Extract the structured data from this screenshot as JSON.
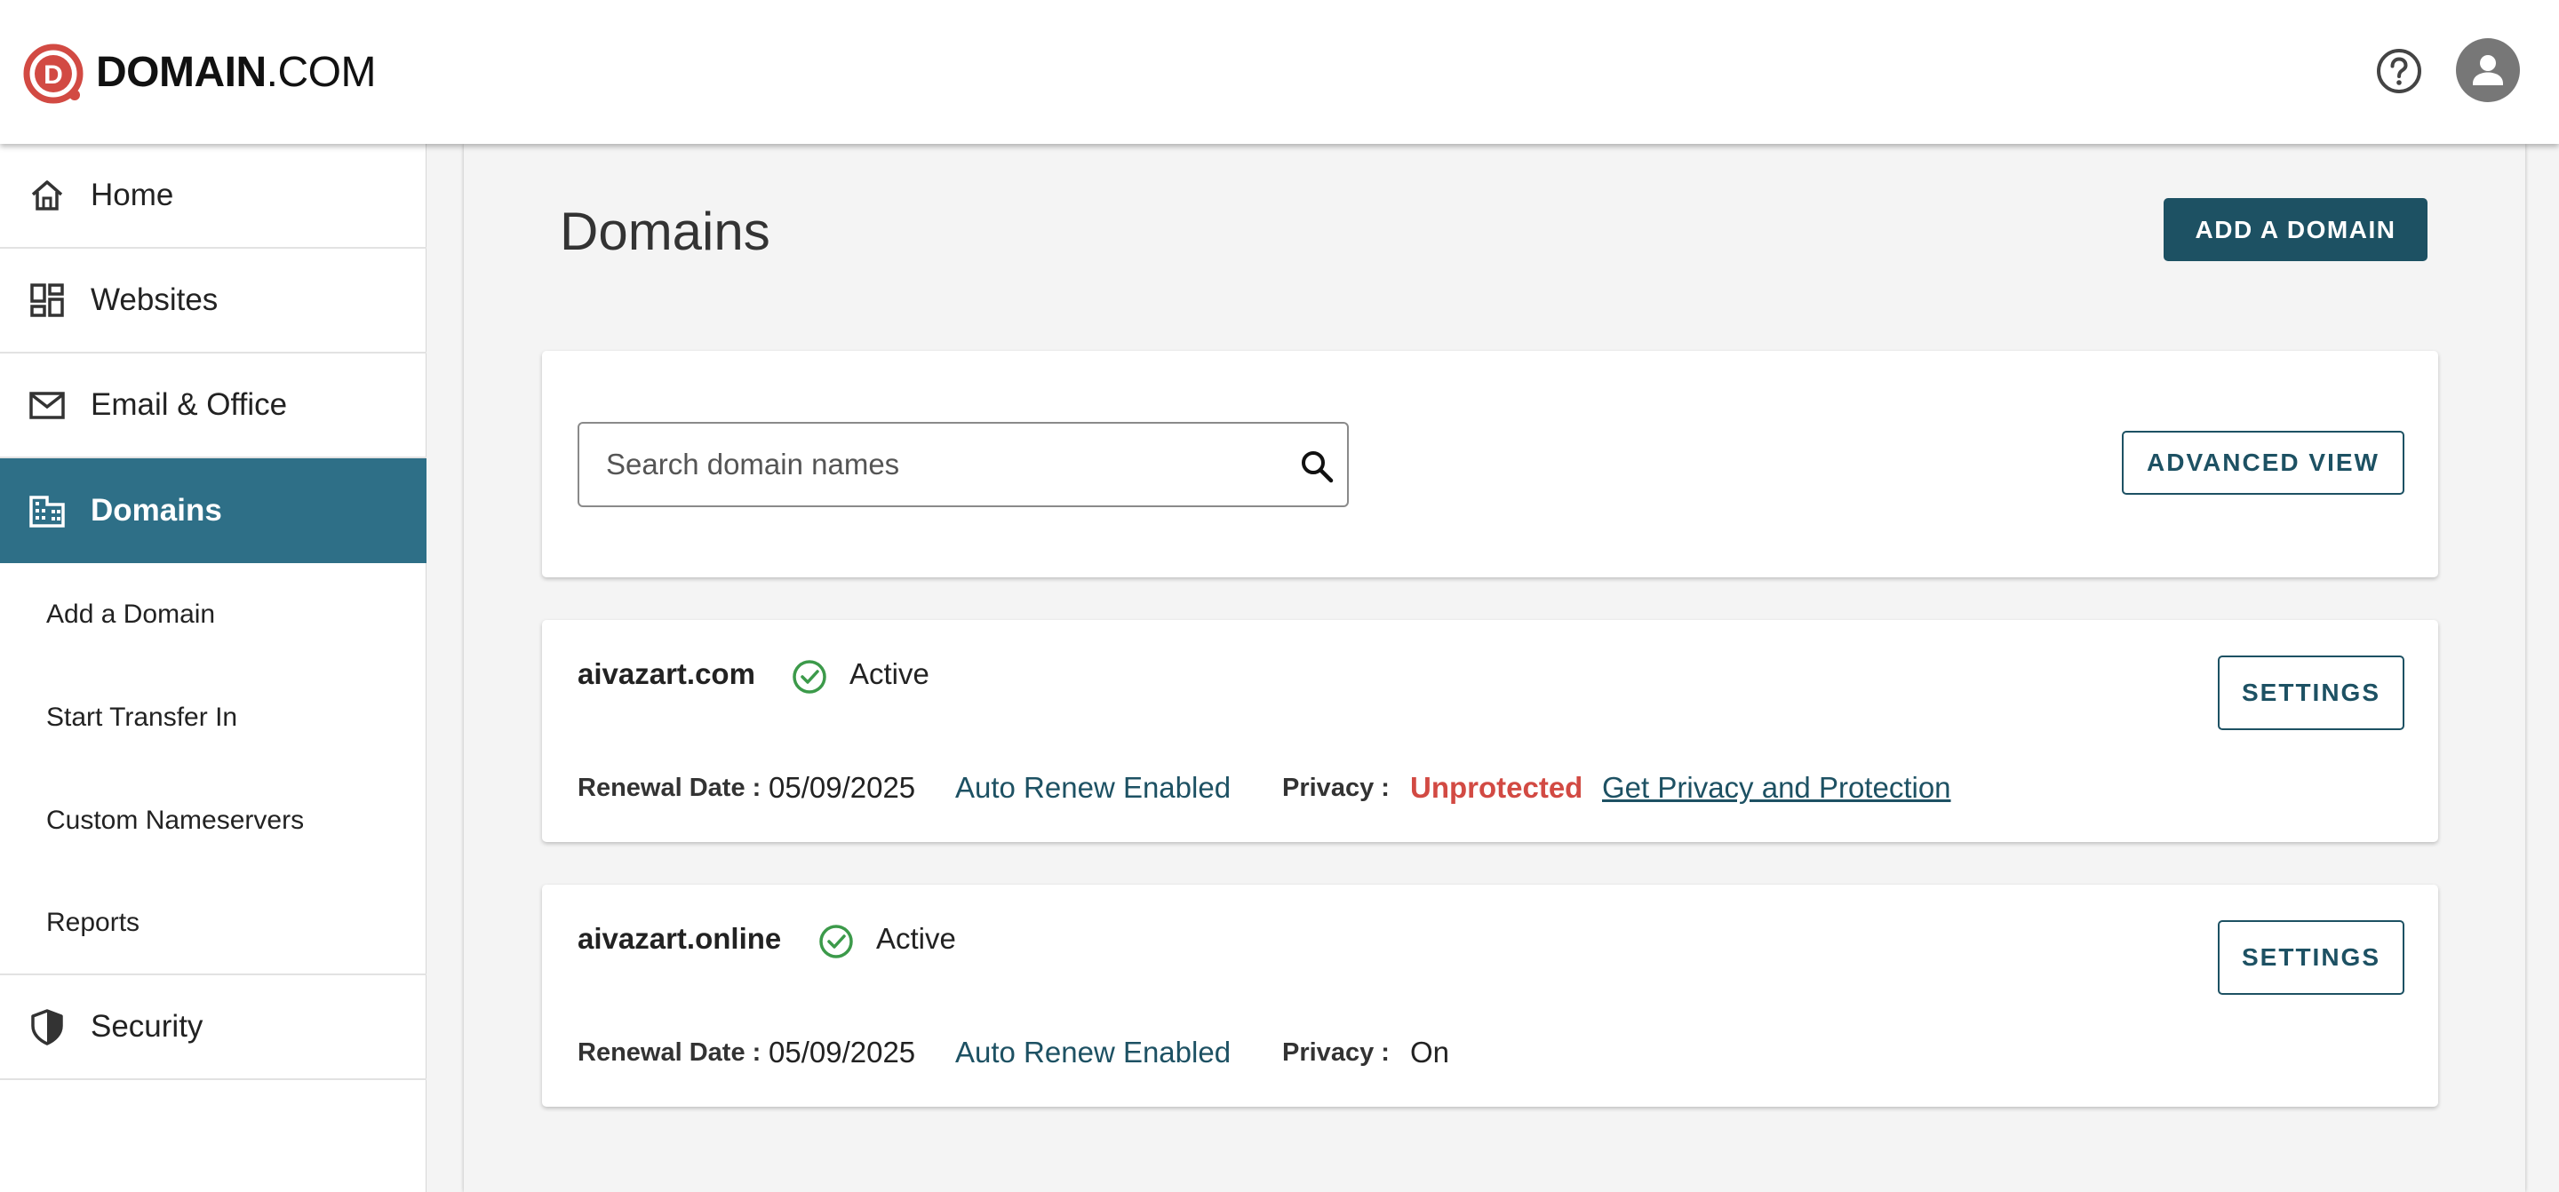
{
  "brand": {
    "logo_bold": "DOMAIN",
    "logo_light": ".COM",
    "accent": "#d24a43",
    "primary": "#1d5163",
    "active_nav": "#2e6f87"
  },
  "header": {
    "help_icon": "question-circle-icon",
    "avatar_icon": "user-avatar-icon"
  },
  "sidebar": {
    "items": [
      {
        "label": "Home",
        "icon": "home-icon"
      },
      {
        "label": "Websites",
        "icon": "dashboard-icon"
      },
      {
        "label": "Email & Office",
        "icon": "mail-icon"
      },
      {
        "label": "Domains",
        "icon": "building-icon",
        "active": true
      }
    ],
    "subitems": [
      {
        "label": "Add a Domain"
      },
      {
        "label": "Start Transfer In"
      },
      {
        "label": "Custom Nameservers"
      },
      {
        "label": "Reports"
      }
    ],
    "footer_item": {
      "label": "Security",
      "icon": "shield-icon"
    }
  },
  "main": {
    "title": "Domains",
    "add_domain_label": "ADD A DOMAIN",
    "search": {
      "placeholder": "Search domain names",
      "value": ""
    },
    "advanced_view_label": "ADVANCED VIEW"
  },
  "domains": [
    {
      "name": "aivazart.com",
      "status": "Active",
      "renewal_label": "Renewal Date :",
      "renewal_date": "05/09/2025",
      "auto_renew": "Auto Renew Enabled",
      "privacy_label": "Privacy :",
      "privacy_value": "Unprotected",
      "privacy_link": "Get Privacy and Protection",
      "settings_label": "SETTINGS"
    },
    {
      "name": "aivazart.online",
      "status": "Active",
      "renewal_label": "Renewal Date :",
      "renewal_date": "05/09/2025",
      "auto_renew": "Auto Renew Enabled",
      "privacy_label": "Privacy :",
      "privacy_value": "On",
      "settings_label": "SETTINGS"
    }
  ]
}
